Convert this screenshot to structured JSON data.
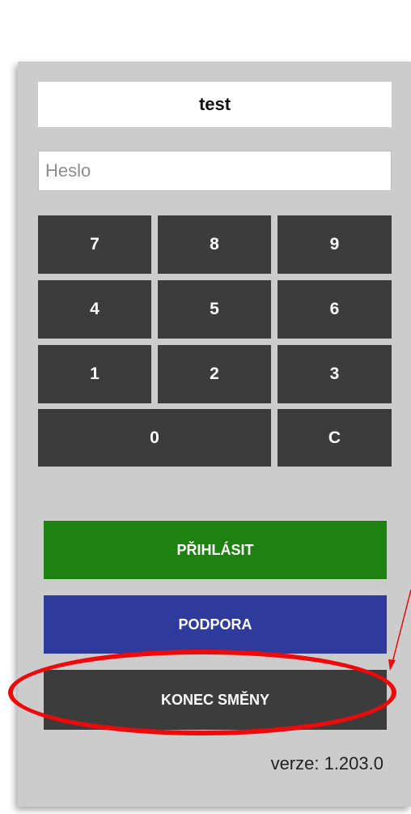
{
  "login": {
    "username": "test",
    "password_placeholder": "Heslo",
    "password_value": ""
  },
  "keypad": {
    "keys": [
      "7",
      "8",
      "9",
      "4",
      "5",
      "6",
      "1",
      "2",
      "3",
      "0",
      "C"
    ]
  },
  "buttons": {
    "login_label": "PŘIHLÁSIT",
    "support_label": "PODPORA",
    "end_shift_label": "KONEC SMĚNY"
  },
  "footer": {
    "version": "verze: 1.203.0"
  },
  "colors": {
    "panel_bg": "#cccccc",
    "key_bg": "#3d3c3c",
    "login_green": "#1e8210",
    "support_blue": "#2e3b9d",
    "annotation_red": "#ee0a0a"
  }
}
